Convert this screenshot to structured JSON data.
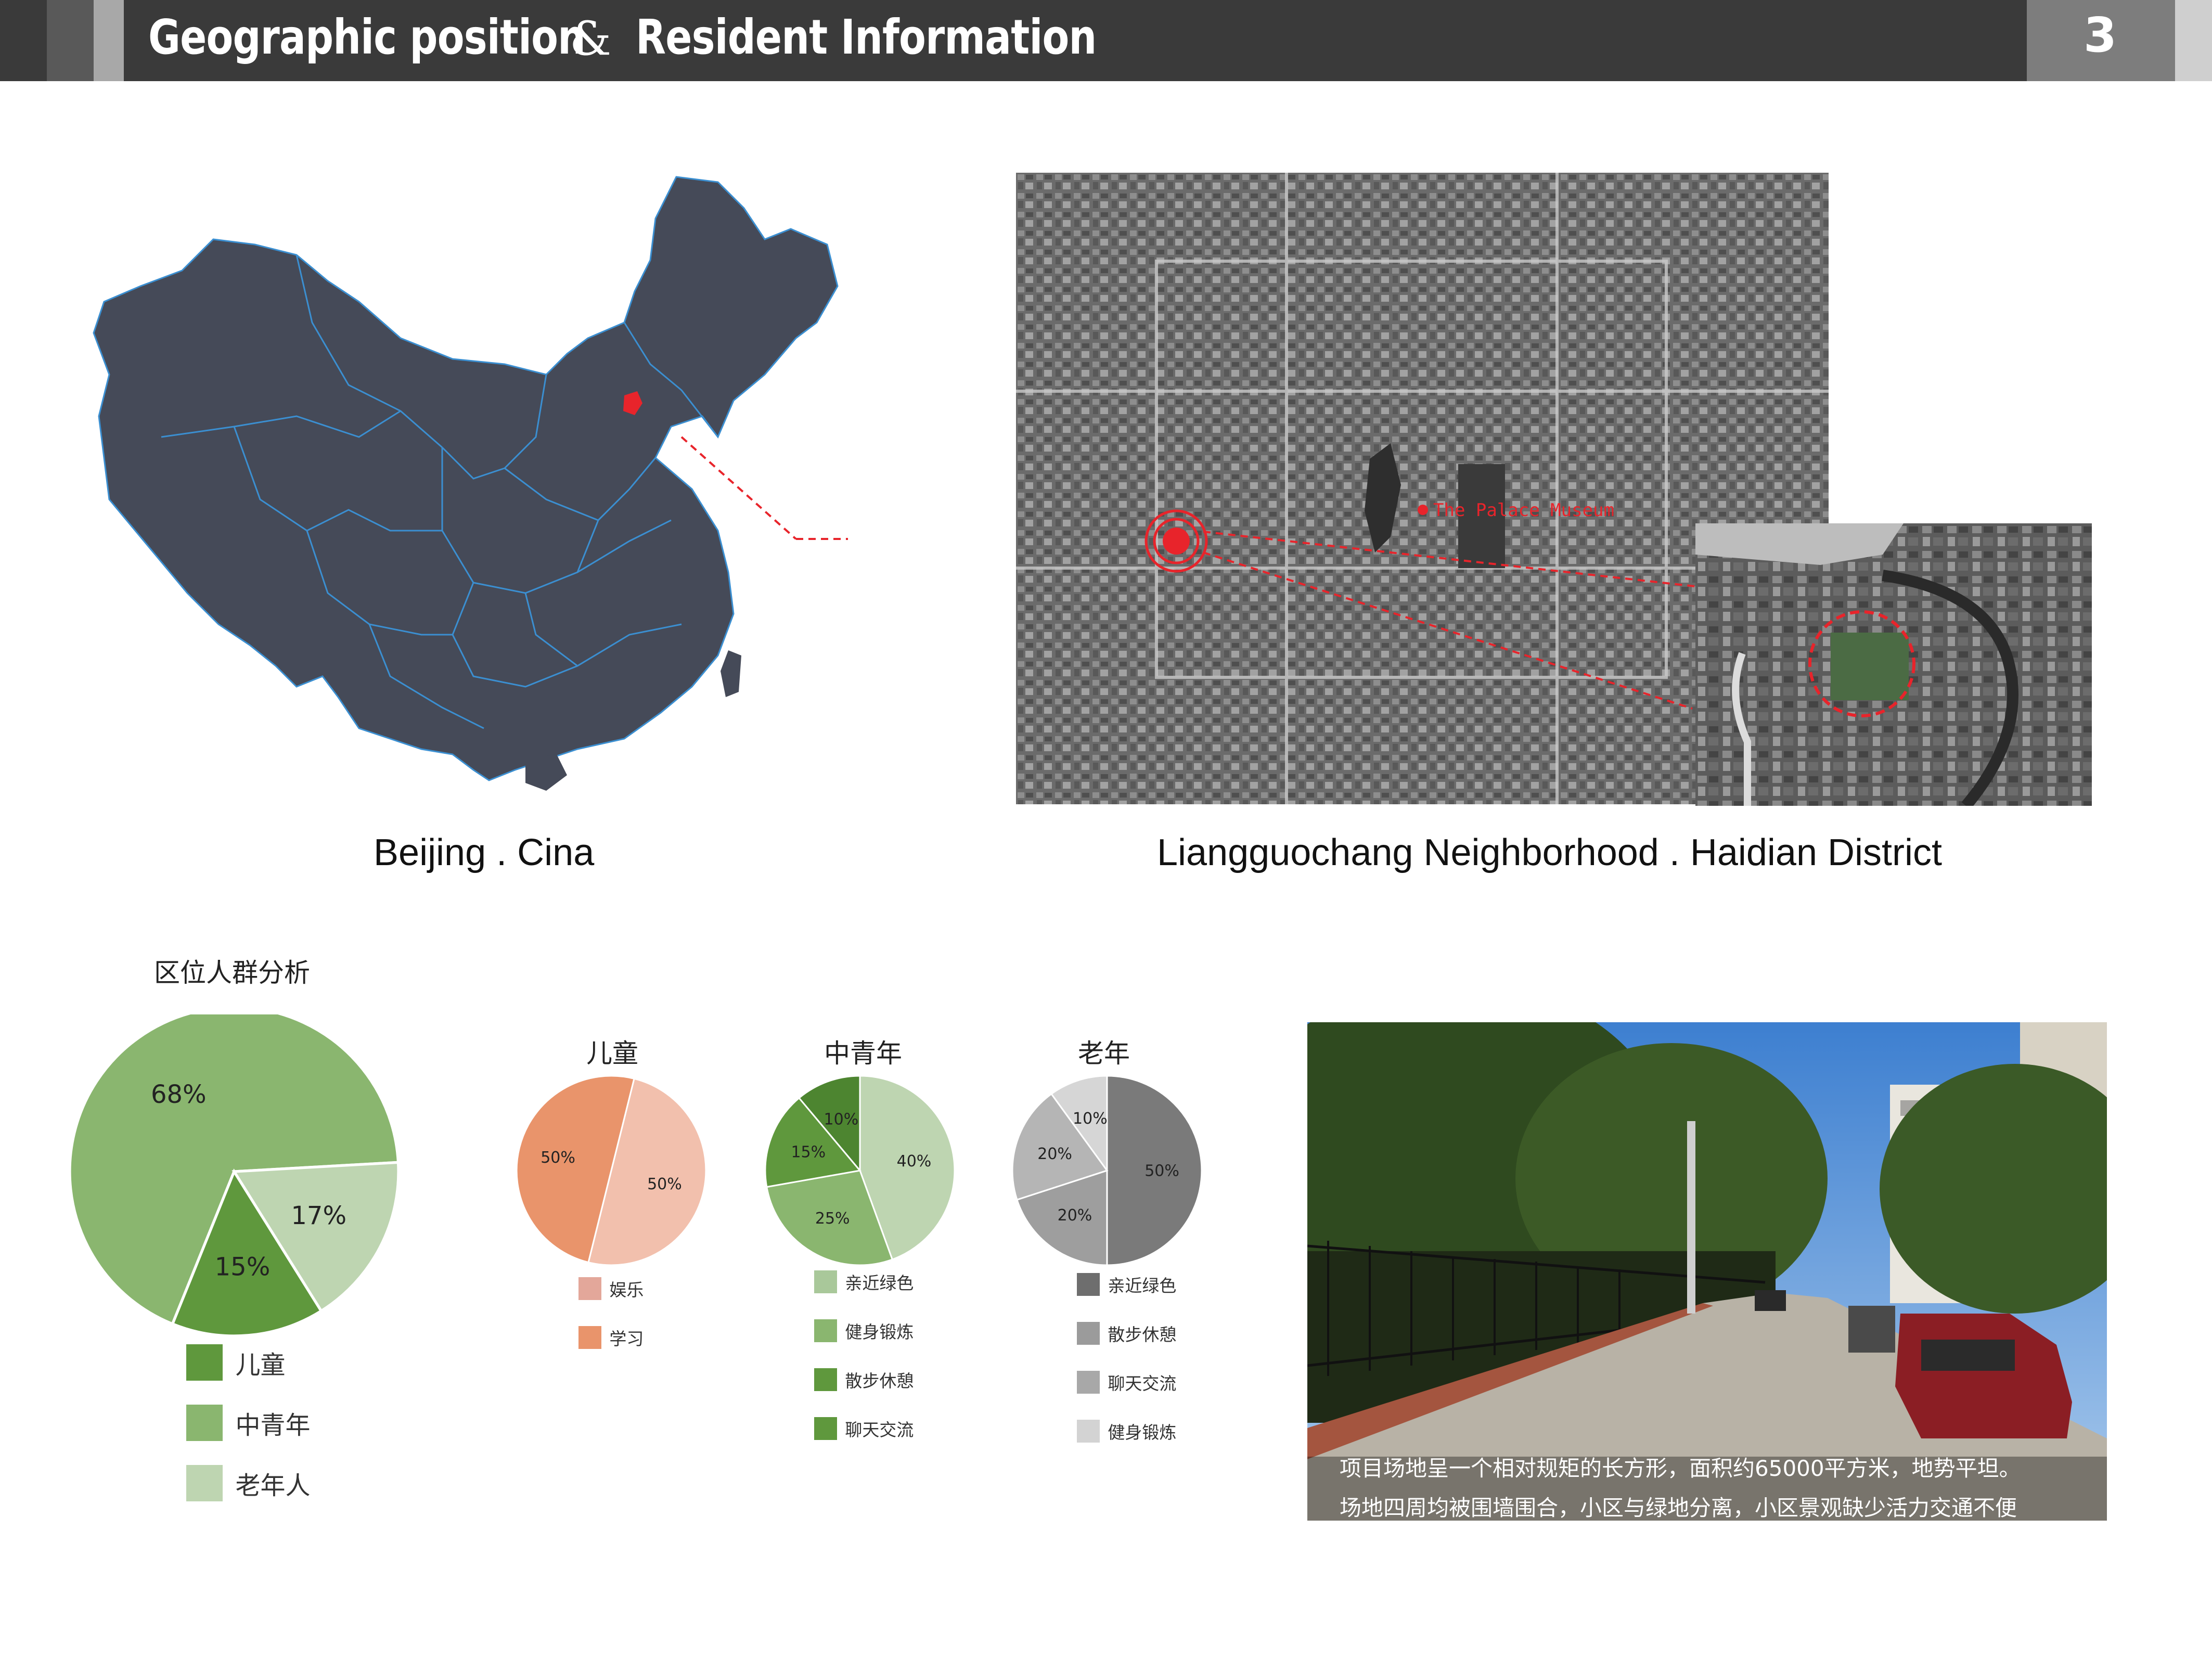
{
  "header": {
    "title_left": "Geographic position",
    "amp": "&",
    "title_right": "Resident Information",
    "page_number": "3"
  },
  "captions": {
    "left": "Beijing . Cina",
    "right": "Liangguochang Neighborhood . Haidian District"
  },
  "map_label": "The Palace Museum",
  "street_caption": [
    "项目场地呈一个相对规矩的长方形，面积约65000平方米，地势平坦。",
    "场地四周均被围墙围合，小区与绿地分离，小区景观缺少活力交通不便"
  ],
  "colors": {
    "header_bg": "#3a3a3a",
    "china_fill": "#454a58",
    "china_border": "#3b8fd1",
    "beijing_red": "#e8242b",
    "green_dark": "#5f983d",
    "green_mid": "#8ab66f",
    "green_light": "#bed5b1",
    "orange_dark": "#e9946b",
    "orange_light": "#f2c0ad",
    "gray_dark": "#7a7a7a",
    "gray_mid": "#9e9e9e",
    "gray_light": "#b5b5b5",
    "gray_pale": "#d6d6d6"
  },
  "chart_data": [
    {
      "type": "pie",
      "title": "区位人群分析",
      "categories": [
        "中青年",
        "老年人",
        "儿童"
      ],
      "values": [
        68,
        17,
        15
      ],
      "labels": [
        "68%",
        "17%",
        "15%"
      ],
      "colors": [
        "#8ab66f",
        "#bed5b1",
        "#5f983d"
      ],
      "legend": [
        {
          "label": "儿童",
          "color": "#5f983d"
        },
        {
          "label": "中青年",
          "color": "#8ab66f"
        },
        {
          "label": "老年人",
          "color": "#bed5b1"
        }
      ],
      "legend_position": "bottom"
    },
    {
      "type": "pie",
      "title": "儿童",
      "categories": [
        "学习",
        "娱乐"
      ],
      "values": [
        50,
        50
      ],
      "labels": [
        "50%",
        "50%"
      ],
      "colors": [
        "#f2c0ad",
        "#e9946b"
      ],
      "legend": [
        {
          "label": "娱乐",
          "color": "#e3a79a"
        },
        {
          "label": "学习",
          "color": "#e9946b"
        }
      ],
      "legend_position": "bottom"
    },
    {
      "type": "pie",
      "title": "中青年",
      "categories": [
        "亲近绿色",
        "健身锻炼",
        "散步休憩",
        "聊天交流"
      ],
      "values": [
        40,
        25,
        15,
        10
      ],
      "labels": [
        "40%",
        "25%",
        "15%",
        "10%"
      ],
      "colors": [
        "#bed5b1",
        "#8ab66f",
        "#5f983d",
        "#4d8530"
      ],
      "legend": [
        {
          "label": "亲近绿色",
          "color": "#a9c89a"
        },
        {
          "label": "健身锻炼",
          "color": "#8ab66f"
        },
        {
          "label": "散步休憩",
          "color": "#5f983d"
        },
        {
          "label": "聊天交流",
          "color": "#5f983d"
        }
      ],
      "legend_position": "bottom"
    },
    {
      "type": "pie",
      "title": "老年",
      "categories": [
        "亲近绿色",
        "散步休憩",
        "聊天交流",
        "健身锻炼"
      ],
      "values": [
        50,
        20,
        20,
        10
      ],
      "labels": [
        "50%",
        "20%",
        "20%",
        "10%"
      ],
      "colors": [
        "#7a7a7a",
        "#9e9e9e",
        "#b5b5b5",
        "#d6d6d6"
      ],
      "legend": [
        {
          "label": "亲近绿色",
          "color": "#6e6e6e"
        },
        {
          "label": "散步休憩",
          "color": "#9b9b9b"
        },
        {
          "label": "聊天交流",
          "color": "#a8a8a8"
        },
        {
          "label": "健身锻炼",
          "color": "#d3d3d3"
        }
      ],
      "legend_position": "bottom"
    }
  ]
}
